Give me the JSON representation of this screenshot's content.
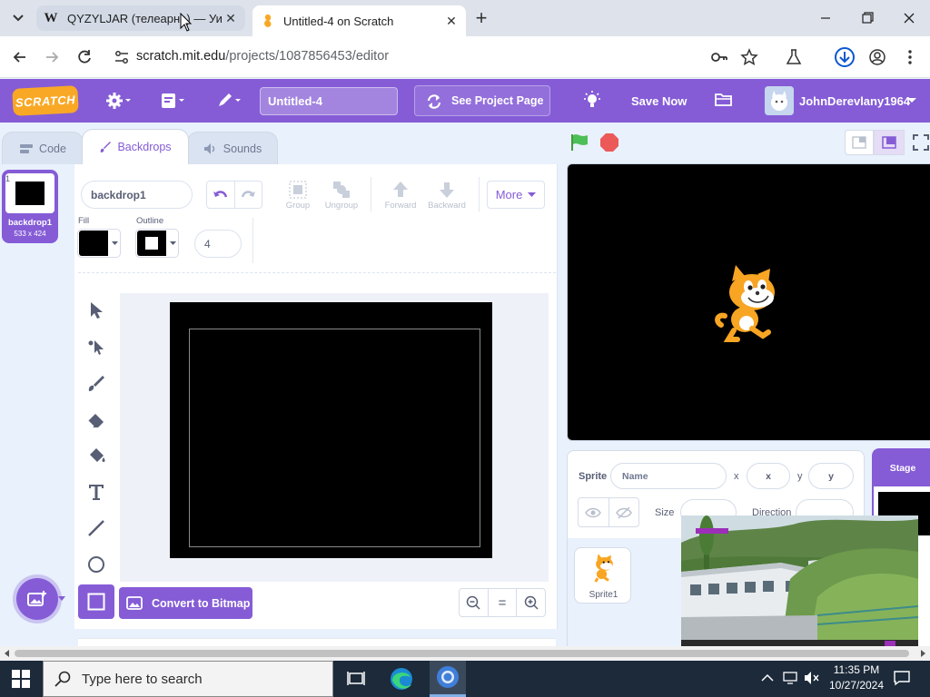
{
  "browser": {
    "tabs": [
      {
        "favicon": "W",
        "title": "QYZYLJAR (телеарна) — Уики"
      },
      {
        "title": "Untitled-4 on Scratch"
      }
    ],
    "close_glyph": "✕",
    "new_tab_glyph": "+",
    "url_host": "scratch.mit.edu",
    "url_path": "/projects/1087856453/editor"
  },
  "scratch_menu": {
    "logo_text": "SCRATCH",
    "project_title": "Untitled-4",
    "see_project_page": "See Project Page",
    "save_now": "Save Now",
    "username": "JohnDerevlany1964"
  },
  "editor_tabs": [
    "Code",
    "Backdrops",
    "Sounds"
  ],
  "backdrop_list": [
    {
      "index": "1",
      "name": "backdrop1",
      "size": "533 x 424"
    }
  ],
  "paint_editor": {
    "backdrop_name": "backdrop1",
    "group_label": "Group",
    "ungroup_label": "Ungroup",
    "forward_label": "Forward",
    "backward_label": "Backward",
    "more_label": "More",
    "fill_label": "Fill",
    "outline_label": "Outline",
    "outline_width": "4",
    "fill_color": "#000000",
    "outline_color": "#ffffff",
    "convert_label": "Convert to Bitmap",
    "zoom_reset_glyph": "="
  },
  "sprite_info": {
    "sprite_label": "Sprite",
    "name_placeholder": "Name",
    "x_label": "x",
    "x_placeholder": "x",
    "y_label": "y",
    "y_placeholder": "y",
    "size_label": "Size",
    "direction_label": "Direction",
    "sprites": [
      {
        "name": "Sprite1"
      }
    ]
  },
  "stage_panel": {
    "label": "Stage"
  },
  "taskbar": {
    "search_placeholder": "Type here to search",
    "time": "11:35 PM",
    "date": "10/27/2024"
  },
  "colors": {
    "accent": "#855cd6",
    "stage_bg": "#000000",
    "green_flag": "#4cbf56",
    "stop": "#ec5959"
  }
}
